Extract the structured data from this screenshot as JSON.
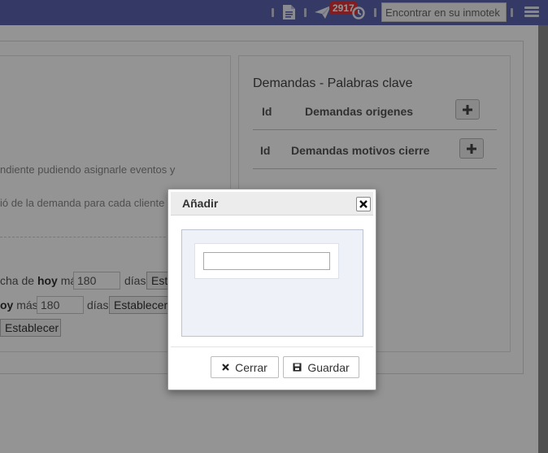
{
  "navbar": {
    "notifications_count": "2917",
    "search_placeholder": "Encontrar en su inmotek",
    "icons": [
      "document-icon",
      "paper-plane-icon",
      "history-icon",
      "hamburger-menu-icon"
    ]
  },
  "left_card": {
    "text_line_1": "ndiente pudiendo asignarle eventos y",
    "text_line_2": "ió de la demanda para cada cliente d",
    "row1": {
      "prefix": "cha de ",
      "bold": "hoy",
      "middle": " más",
      "value": "180",
      "unit": "días",
      "button": "Est"
    },
    "row2": {
      "bold": "oy",
      "middle": " más",
      "value": "180",
      "unit": "días",
      "button": "Establecer"
    },
    "row3": {
      "button": "Establecer"
    }
  },
  "right_card": {
    "title": "Demandas - Palabras clave",
    "section1": {
      "id_header": "Id",
      "name_header": "Demandas origenes"
    },
    "section2": {
      "id_header": "Id",
      "name_header": "Demandas motivos cierre"
    }
  },
  "modal": {
    "title": "Añadir",
    "input_value": "",
    "close_label": "Cerrar",
    "save_label": "Guardar"
  },
  "colors": {
    "navbar": "#5b62b0",
    "badge": "#e0343a",
    "overlay": "rgba(0,0,0,0.42)",
    "modal_body": "#eef2f8"
  }
}
